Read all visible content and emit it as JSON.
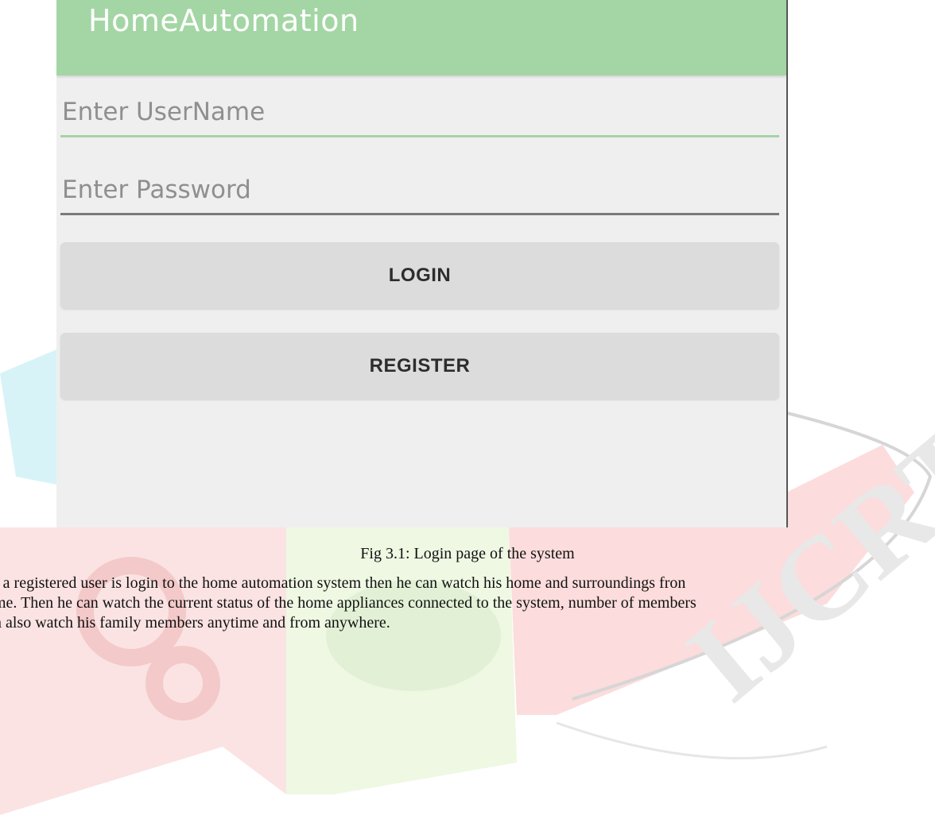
{
  "app": {
    "title": "HomeAutomation"
  },
  "login_form": {
    "username_placeholder": "Enter UserName",
    "password_placeholder": "Enter Password",
    "login_label": "LOGIN",
    "register_label": "REGISTER"
  },
  "document": {
    "caption": "Fig 3.1: Login page of the system",
    "paragraph_lines": [
      "f a registered user is login to the home automation system then he can watch his home and surroundings fron",
      "me. Then he can watch the current status of the home appliances connected to the system, number of members",
      "n also watch his family members anytime and from anywhere."
    ],
    "watermark_text": "IJCRT"
  },
  "colors": {
    "appbar": "#a3d6a4",
    "screen_bg": "#efefef",
    "button_bg": "#dcdcdc",
    "username_underline": "#a4d3a6",
    "password_underline": "#7a7a7a"
  }
}
